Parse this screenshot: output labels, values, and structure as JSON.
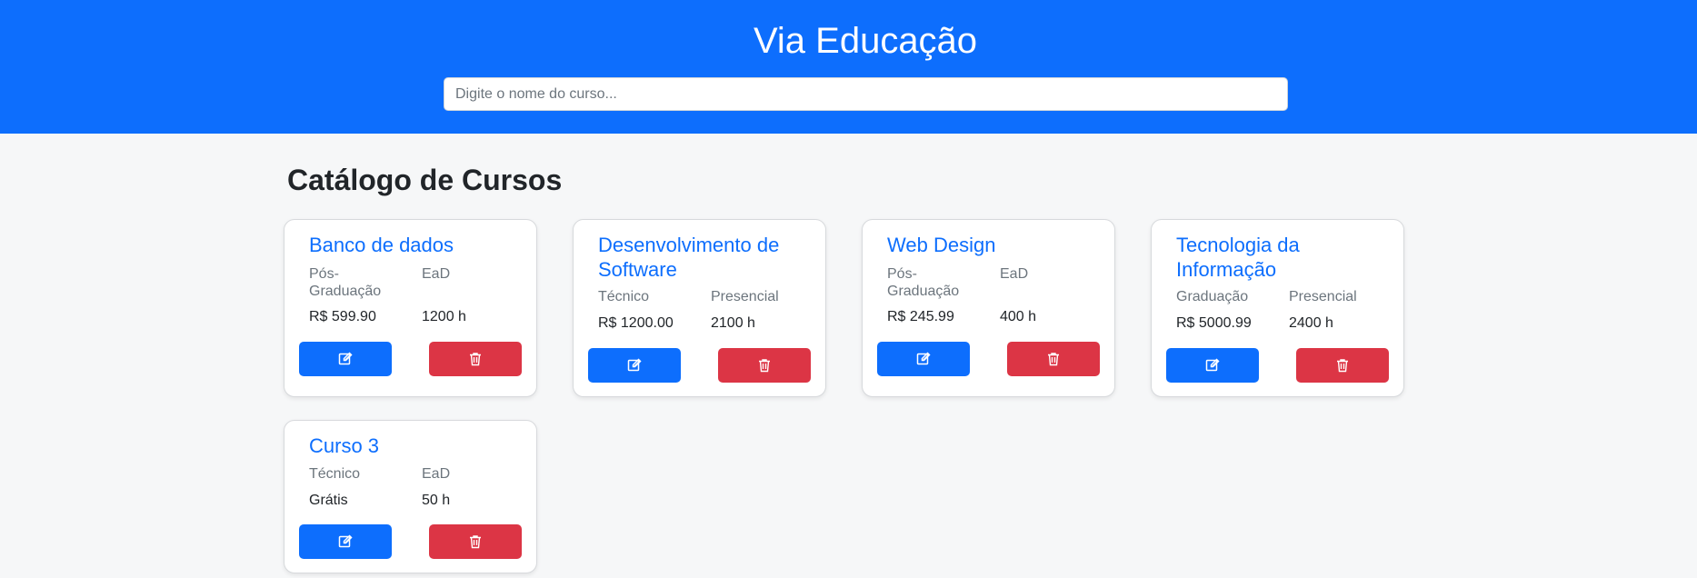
{
  "header": {
    "title": "Via Educação",
    "search_placeholder": "Digite o nome do curso..."
  },
  "main": {
    "heading": "Catálogo de Cursos",
    "courses": [
      {
        "title": "Banco de dados",
        "level": "Pós-Graduação",
        "modality": "EaD",
        "price": "R$ 599.90",
        "hours": "1200 h"
      },
      {
        "title": "Desenvolvimento de Software",
        "level": "Técnico",
        "modality": "Presencial",
        "price": "R$ 1200.00",
        "hours": "2100 h"
      },
      {
        "title": "Web Design",
        "level": "Pós-Graduação",
        "modality": "EaD",
        "price": "R$ 245.99",
        "hours": "400 h"
      },
      {
        "title": "Tecnologia da Informação",
        "level": "Graduação",
        "modality": "Presencial",
        "price": "R$ 5000.99",
        "hours": "2400 h"
      },
      {
        "title": "Curso 3",
        "level": "Técnico",
        "modality": "EaD",
        "price": "Grátis",
        "hours": "50 h"
      }
    ]
  },
  "icons": {
    "edit": "edit-icon",
    "delete": "trash-icon"
  },
  "colors": {
    "primary": "#0d6efd",
    "danger": "#dc3545",
    "background": "#f6f7f8"
  }
}
